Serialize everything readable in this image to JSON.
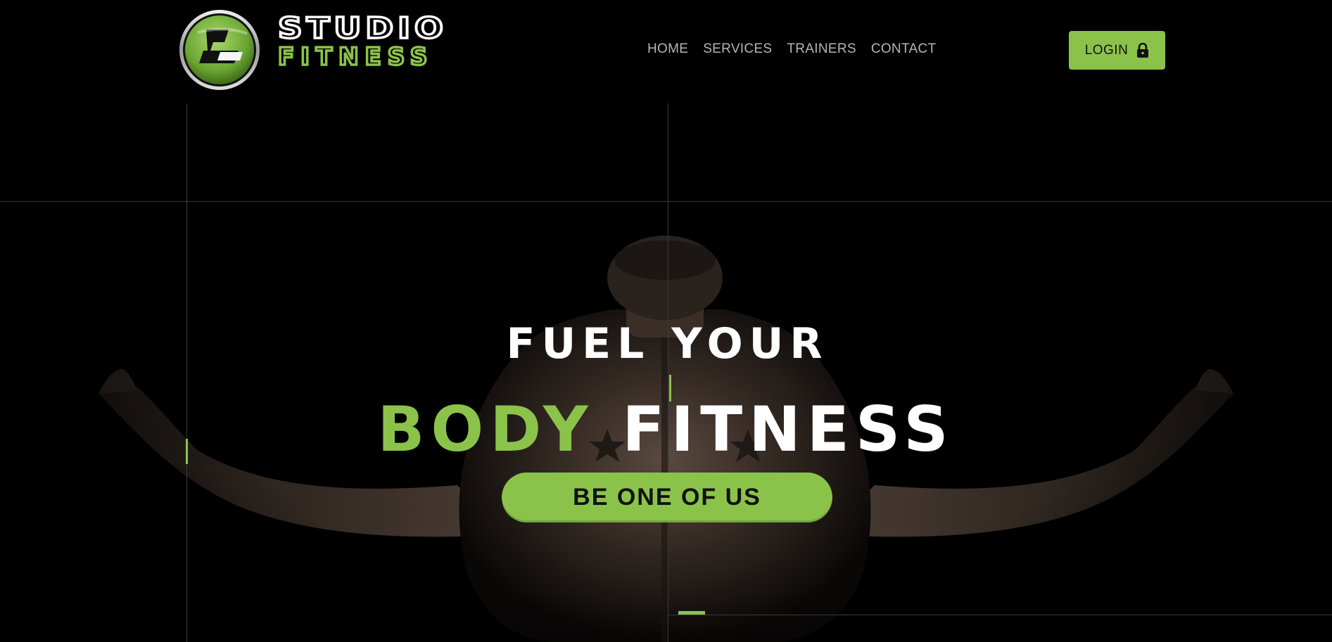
{
  "brand": {
    "line1": "STUDIO",
    "line2": "FITNESS",
    "accent_color": "#8bc34a"
  },
  "nav": {
    "items": [
      "HOME",
      "SERVICES",
      "TRAINERS",
      "CONTACT"
    ]
  },
  "login": {
    "label": "LOGIN",
    "icon": "lock-icon"
  },
  "hero": {
    "headline_line1": "FUEL YOUR",
    "headline_green": "BODY",
    "headline_white": "FITNESS",
    "cta_label": "BE ONE OF US"
  }
}
